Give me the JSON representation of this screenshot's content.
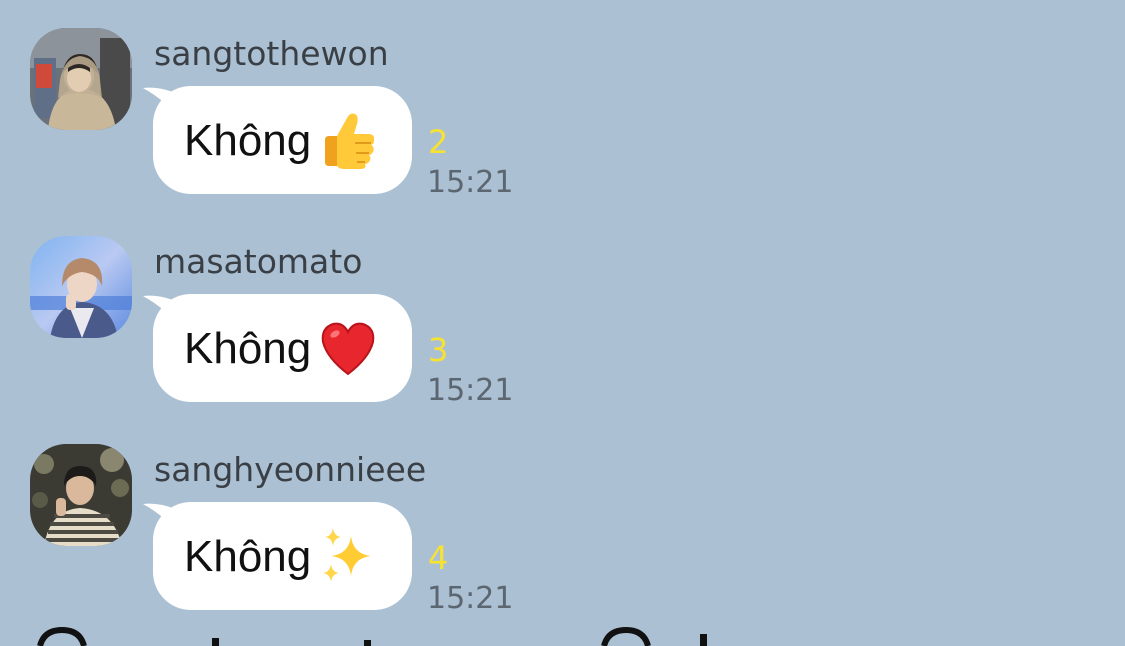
{
  "chat": {
    "messages": [
      {
        "sender": "sangtothewon",
        "text": "Không",
        "emoji": "thumbs-up-icon",
        "read_count": "2",
        "time": "15:21"
      },
      {
        "sender": "masatomato",
        "text": "Không",
        "emoji": "red-heart-icon",
        "read_count": "3",
        "time": "15:21"
      },
      {
        "sender": "sanghyeonnieee",
        "text": "Không",
        "emoji": "sparkles-icon",
        "read_count": "4",
        "time": "15:21"
      }
    ]
  },
  "colors": {
    "background": "#abc1d3",
    "bubble": "#ffffff",
    "read_count": "#f7e231",
    "time": "#5b6670",
    "sender": "#3a3f46"
  }
}
